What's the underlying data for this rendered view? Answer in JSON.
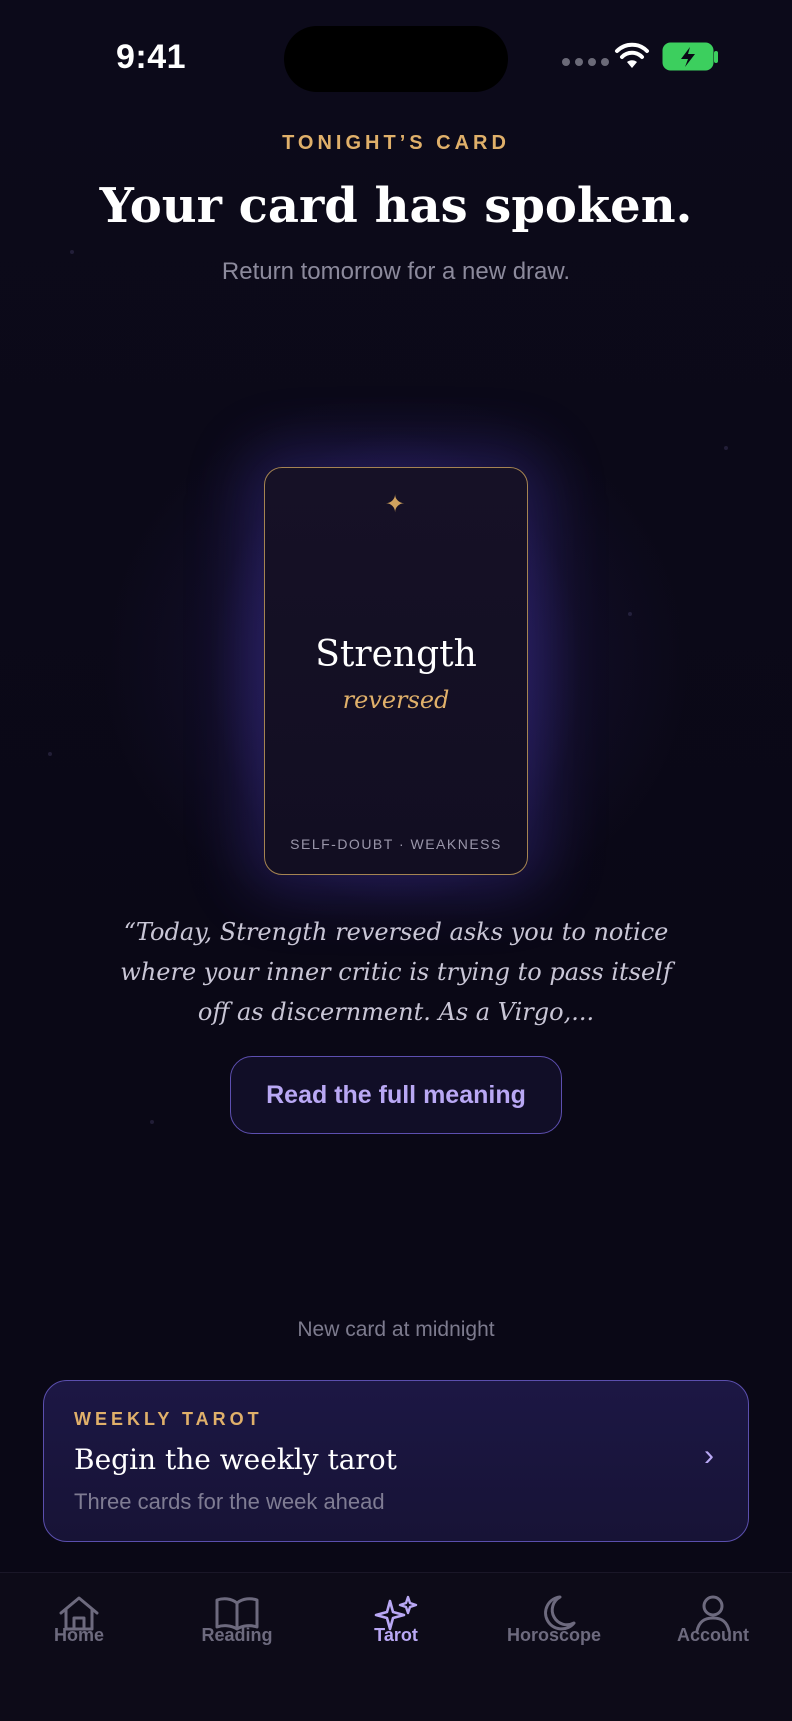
{
  "status_bar": {
    "time": "9:41"
  },
  "header": {
    "eyebrow": "TONIGHT’S CARD",
    "title": "Your card has spoken.",
    "subtitle": "Return tomorrow for a new draw."
  },
  "card": {
    "name": "Strength",
    "orientation": "reversed",
    "keywords": "SELF-DOUBT · WEAKNESS",
    "icon": "sparkle-icon"
  },
  "quote": "“Today, Strength reversed asks you to notice where your inner critic is trying to pass itself off as discernment. As a Virgo,...",
  "actions": {
    "read_meaning": "Read the full meaning"
  },
  "next_card_note": "New card at midnight",
  "weekly": {
    "eyebrow": "WEEKLY TAROT",
    "title": "Begin the weekly tarot",
    "subtitle": "Three cards for the week ahead",
    "chevron": "›"
  },
  "tabs": [
    {
      "label": "Home",
      "icon": "home-icon",
      "active": false
    },
    {
      "label": "Reading",
      "icon": "book-icon",
      "active": false
    },
    {
      "label": "Tarot",
      "icon": "sparkles-icon",
      "active": true
    },
    {
      "label": "Horoscope",
      "icon": "moon-icon",
      "active": false
    },
    {
      "label": "Account",
      "icon": "person-icon",
      "active": false
    }
  ],
  "colors": {
    "accent_gold": "#e0b06a",
    "accent_violet": "#b9a8f4",
    "background": "#0a0816"
  }
}
